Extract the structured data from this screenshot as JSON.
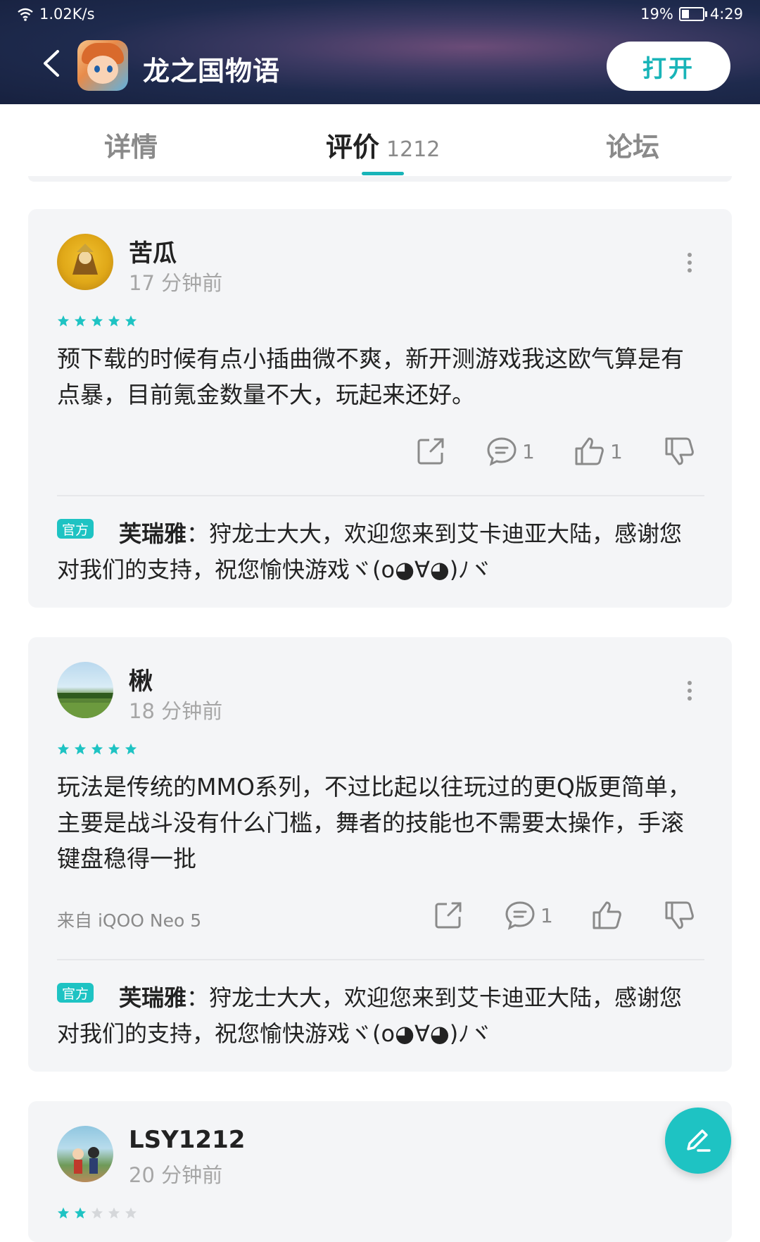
{
  "status_bar": {
    "network_speed": "1.02K/s",
    "battery": "19%",
    "time": "4:29"
  },
  "header": {
    "app_title": "龙之国物语",
    "open_button": "打开"
  },
  "tabs": [
    {
      "label": "详情",
      "count": ""
    },
    {
      "label": "评价",
      "count": "1212"
    },
    {
      "label": "论坛",
      "count": ""
    }
  ],
  "accent_color": "#19b4b8",
  "reviews": [
    {
      "username": "苦瓜",
      "time": "17 分钟前",
      "stars": 5,
      "text": "预下载的时候有点小插曲微不爽，新开测游戏我这欧气算是有点暴，目前氪金数量不大，玩起来还好。",
      "device": "",
      "comment_count": "1",
      "like_count": "1",
      "reply": {
        "tag": "官方",
        "name": "芙瑞雅",
        "text": "：狩龙士大大，欢迎您来到艾卡迪亚大陆，感谢您对我们的支持，祝您愉快游戏ヾ(o◕∀◕)ﾉヾ"
      }
    },
    {
      "username": "楸",
      "time": "18 分钟前",
      "stars": 5,
      "text": "玩法是传统的MMO系列，不过比起以往玩过的更Q版更简单，主要是战斗没有什么门槛，舞者的技能也不需要太操作，手滚键盘稳得一批",
      "device": "来自 iQOO Neo 5",
      "comment_count": "1",
      "like_count": "",
      "reply": {
        "tag": "官方",
        "name": "芙瑞雅",
        "text": "：狩龙士大大，欢迎您来到艾卡迪亚大陆，感谢您对我们的支持，祝您愉快游戏ヾ(o◕∀◕)ﾉヾ"
      }
    },
    {
      "username": "LSY1212",
      "time": "20 分钟前",
      "stars": 2
    }
  ]
}
